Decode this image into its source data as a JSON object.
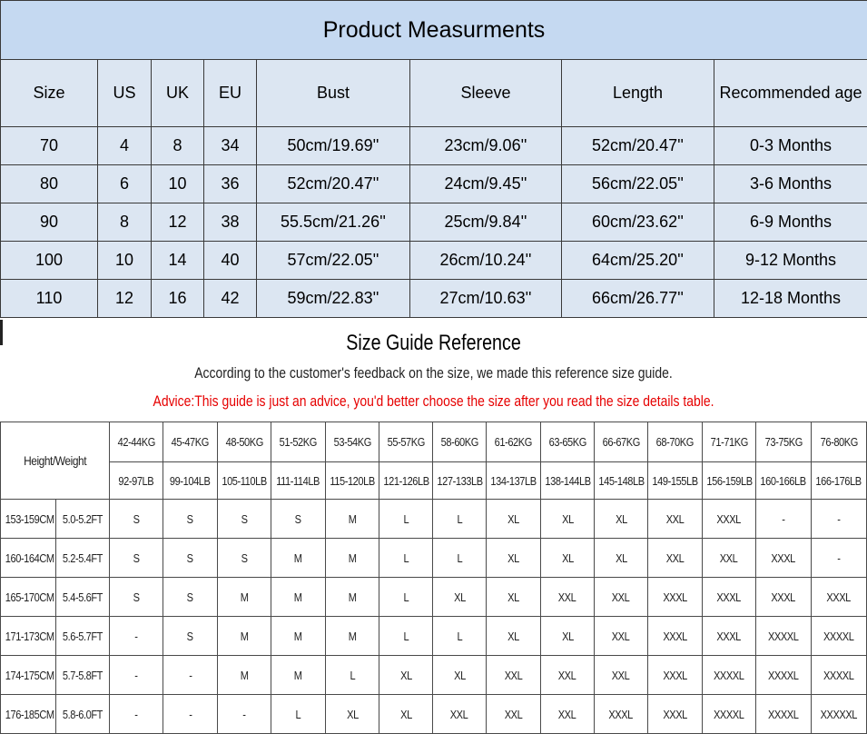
{
  "measurements": {
    "title": "Product Measurments",
    "headers": [
      "Size",
      "US",
      "UK",
      "EU",
      "Bust",
      "Sleeve",
      "Length",
      "Recommended age"
    ],
    "rows": [
      [
        "70",
        "4",
        "8",
        "34",
        "50cm/19.69''",
        "23cm/9.06''",
        "52cm/20.47''",
        "0-3 Months"
      ],
      [
        "80",
        "6",
        "10",
        "36",
        "52cm/20.47''",
        "24cm/9.45''",
        "56cm/22.05''",
        "3-6 Months"
      ],
      [
        "90",
        "8",
        "12",
        "38",
        "55.5cm/21.26''",
        "25cm/9.84''",
        "60cm/23.62''",
        "6-9 Months"
      ],
      [
        "100",
        "10",
        "14",
        "40",
        "57cm/22.05''",
        "26cm/10.24''",
        "64cm/25.20''",
        "9-12 Months"
      ],
      [
        "110",
        "12",
        "16",
        "42",
        "59cm/22.83''",
        "27cm/10.63''",
        "66cm/26.77''",
        "12-18 Months"
      ]
    ]
  },
  "guide": {
    "title": "Size Guide Reference",
    "subtitle": "According to the customer's feedback on the size,  we made this reference size guide.",
    "advice": "Advice:This guide is just an advice,  you'd better choose the size after you read the size details table.",
    "header_label": "Height/Weight",
    "weights_kg": [
      "42-44KG",
      "45-47KG",
      "48-50KG",
      "51-52KG",
      "53-54KG",
      "55-57KG",
      "58-60KG",
      "61-62KG",
      "63-65KG",
      "66-67KG",
      "68-70KG",
      "71-71KG",
      "73-75KG",
      "76-80KG"
    ],
    "weights_lb": [
      "92-97LB",
      "99-104LB",
      "105-110LB",
      "111-114LB",
      "115-120LB",
      "121-126LB",
      "127-133LB",
      "134-137LB",
      "138-144LB",
      "145-148LB",
      "149-155LB",
      "156-159LB",
      "160-166LB",
      "166-176LB"
    ],
    "rows": [
      {
        "cm": "153-159CM",
        "ft": "5.0-5.2FT",
        "sizes": [
          "S",
          "S",
          "S",
          "S",
          "M",
          "L",
          "L",
          "XL",
          "XL",
          "XL",
          "XXL",
          "XXXL",
          "-",
          "-"
        ]
      },
      {
        "cm": "160-164CM",
        "ft": "5.2-5.4FT",
        "sizes": [
          "S",
          "S",
          "S",
          "M",
          "M",
          "L",
          "L",
          "XL",
          "XL",
          "XL",
          "XXL",
          "XXL",
          "XXXL",
          "-"
        ]
      },
      {
        "cm": "165-170CM",
        "ft": "5.4-5.6FT",
        "sizes": [
          "S",
          "S",
          "M",
          "M",
          "M",
          "L",
          "XL",
          "XL",
          "XXL",
          "XXL",
          "XXXL",
          "XXXL",
          "XXXL",
          "XXXL"
        ]
      },
      {
        "cm": "171-173CM",
        "ft": "5.6-5.7FT",
        "sizes": [
          "-",
          "S",
          "M",
          "M",
          "M",
          "L",
          "L",
          "XL",
          "XL",
          "XXL",
          "XXXL",
          "XXXL",
          "XXXXL",
          "XXXXL"
        ]
      },
      {
        "cm": "174-175CM",
        "ft": "5.7-5.8FT",
        "sizes": [
          "-",
          "-",
          "M",
          "M",
          "L",
          "XL",
          "XL",
          "XXL",
          "XXL",
          "XXL",
          "XXXL",
          "XXXXL",
          "XXXXL",
          "XXXXL"
        ]
      },
      {
        "cm": "176-185CM",
        "ft": "5.8-6.0FT",
        "sizes": [
          "-",
          "-",
          "-",
          "L",
          "XL",
          "XL",
          "XXL",
          "XXL",
          "XXL",
          "XXXL",
          "XXXL",
          "XXXXL",
          "XXXXL",
          "XXXXXL"
        ]
      }
    ]
  }
}
